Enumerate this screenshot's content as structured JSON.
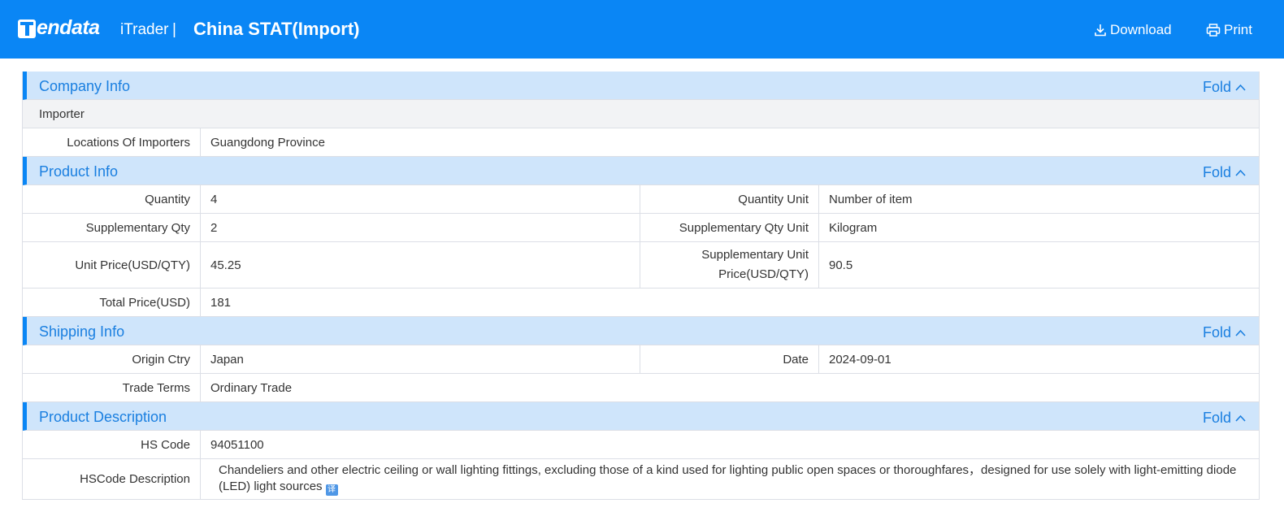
{
  "header": {
    "logo_text": "endata",
    "product": "iTrader",
    "separator": "|",
    "title": "China STAT(Import)",
    "download_label": "Download",
    "print_label": "Print"
  },
  "fold_label": "Fold",
  "company": {
    "title": "Company Info",
    "importer_label": "Importer",
    "locations_label": "Locations Of Importers",
    "locations_value": "Guangdong Province"
  },
  "product": {
    "title": "Product Info",
    "quantity_label": "Quantity",
    "quantity_value": "4",
    "quantity_unit_label": "Quantity Unit",
    "quantity_unit_value": "Number of item",
    "supp_qty_label": "Supplementary Qty",
    "supp_qty_value": "2",
    "supp_qty_unit_label": "Supplementary Qty Unit",
    "supp_qty_unit_value": "Kilogram",
    "unit_price_label": "Unit Price(USD/QTY)",
    "unit_price_value": "45.25",
    "supp_unit_price_label": "Supplementary Unit Price(USD/QTY)",
    "supp_unit_price_value": "90.5",
    "total_price_label": "Total Price(USD)",
    "total_price_value": "181"
  },
  "shipping": {
    "title": "Shipping Info",
    "origin_label": "Origin Ctry",
    "origin_value": "Japan",
    "date_label": "Date",
    "date_value": "2024-09-01",
    "trade_terms_label": "Trade Terms",
    "trade_terms_value": "Ordinary Trade"
  },
  "description": {
    "title": "Product Description",
    "hs_code_label": "HS Code",
    "hs_code_value": "94051100",
    "hs_desc_label": "HSCode Description",
    "hs_desc_value": "Chandeliers and other electric ceiling or wall lighting fittings, excluding those of a kind used for lighting public open spaces or thoroughfares，designed for use solely with light-emitting diode (LED) light sources",
    "translate_icon": "translate-icon"
  },
  "colors": {
    "brand": "#0a86f5",
    "section_bg": "#cfe5fb",
    "section_text": "#1a7fe0"
  }
}
